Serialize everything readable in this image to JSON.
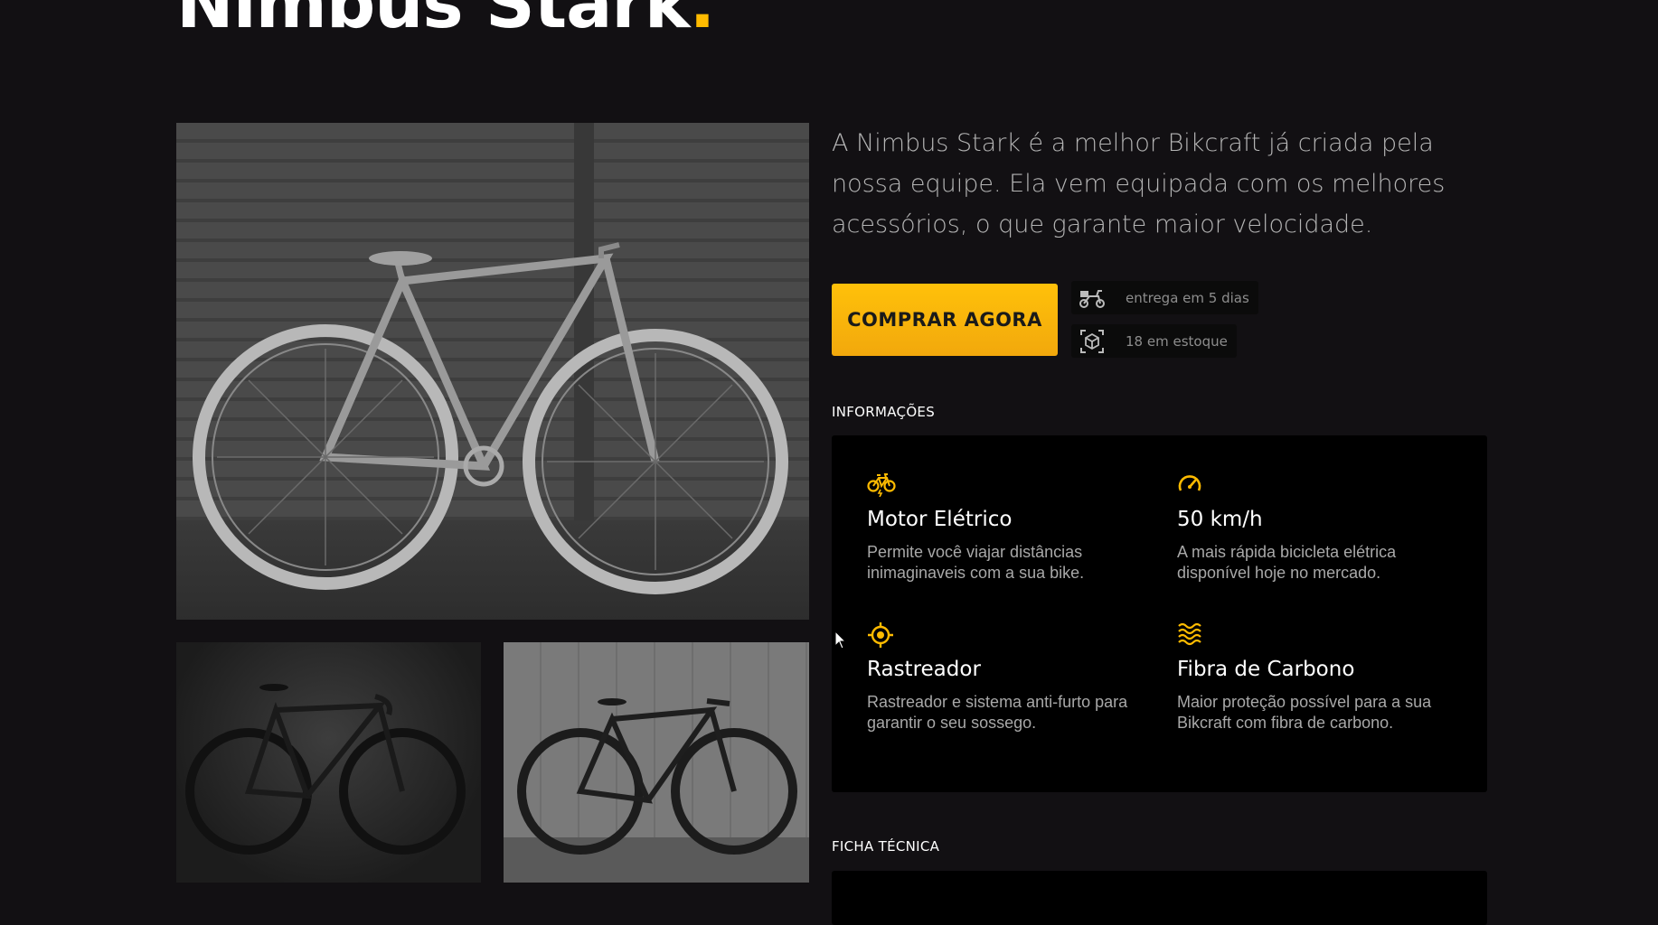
{
  "product": {
    "name": "Nimbus Stark",
    "name_dot": ".",
    "description": "A Nimbus Stark é a melhor Bikcraft já criada pela nossa equipe. Ela vem equipada com os melhores acessórios, o que garante maior velocidade."
  },
  "gallery": {
    "images": [
      {
        "name": "bike-photo-main",
        "icon": "bicycle-photo"
      },
      {
        "name": "bike-photo-thumb-1",
        "icon": "bicycle-photo"
      },
      {
        "name": "bike-photo-thumb-2",
        "icon": "bicycle-photo"
      }
    ]
  },
  "actions": {
    "buy_label": "COMPRAR AGORA"
  },
  "tags": [
    {
      "icon": "delivery-scooter-icon",
      "text": "entrega em 5 dias"
    },
    {
      "icon": "package-box-icon",
      "text": "18 em estoque"
    }
  ],
  "info": {
    "label": "INFORMAÇÕES",
    "features": [
      {
        "icon": "electric-bike-icon",
        "title": "Motor Elétrico",
        "text": "Permite você viajar distâncias inimaginaveis com a sua bike."
      },
      {
        "icon": "speedometer-icon",
        "title": "50 km/h",
        "text": "A mais rápida bicicleta elétrica disponível hoje no mercado."
      },
      {
        "icon": "target-tracker-icon",
        "title": "Rastreador",
        "text": "Rastreador e sistema anti-furto para garantir o seu sossego."
      },
      {
        "icon": "waves-fiber-icon",
        "title": "Fibra de Carbono",
        "text": "Maior proteção possível para a sua Bikcraft com fibra de carbono."
      }
    ]
  },
  "specs": {
    "label": "FICHA TÉCNICA"
  },
  "colors": {
    "background": "#121013",
    "accent": "#FFBB00",
    "panel": "#000000"
  }
}
